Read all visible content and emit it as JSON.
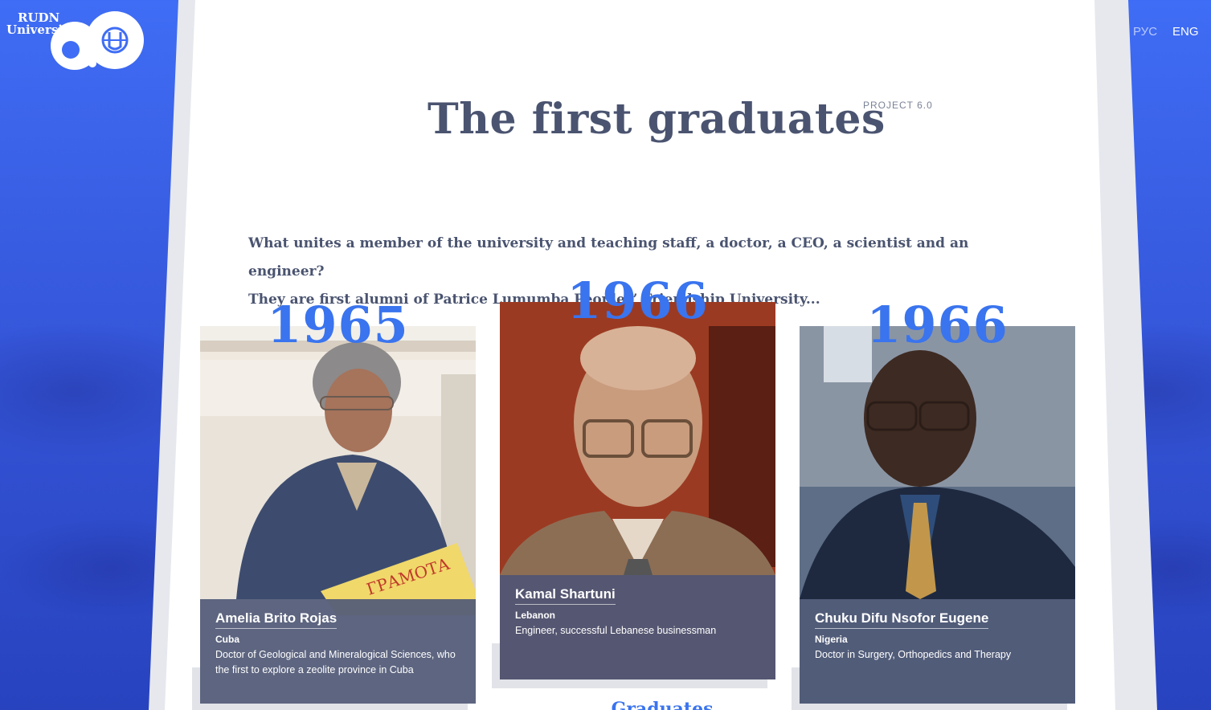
{
  "brand": {
    "logo_line1": "RUDN",
    "logo_line2": "University",
    "logo_mark": "6.0"
  },
  "header": {
    "lang_ru": "РУС",
    "lang_en": "ENG"
  },
  "main": {
    "title": "The first graduates",
    "project_tag": "PROJECT 6.0",
    "intro_line1": "What unites a member of the university and teaching staff, a doctor, a CEO, a scientist and an engineer?",
    "intro_line2": "They are first alumni of Patrice Lumumba Peoples’ Friendship University..."
  },
  "graduates": [
    {
      "year": "1965",
      "name": "Amelia Brito Rojas",
      "country": "Cuba",
      "description": "Doctor of Geological and Mineralogical Sciences, who the first to explore a zeolite province in Cuba",
      "diploma_text": "ГРАМОТА"
    },
    {
      "year": "1966",
      "name": "Kamal Shartuni",
      "country": "Lebanon",
      "description": "Engineer, successful Lebanese businessman"
    },
    {
      "year": "1966",
      "name": "Chuku Difu Nsofor Eugene",
      "country": "Nigeria",
      "description": "Doctor in Surgery, Orthopedics and Therapy"
    }
  ],
  "footer": {
    "partial_text": "... Graduates"
  },
  "colors": {
    "accent_blue": "#3a74ee",
    "title_slate": "#4a5470",
    "background_blue": "#3f6df5"
  }
}
